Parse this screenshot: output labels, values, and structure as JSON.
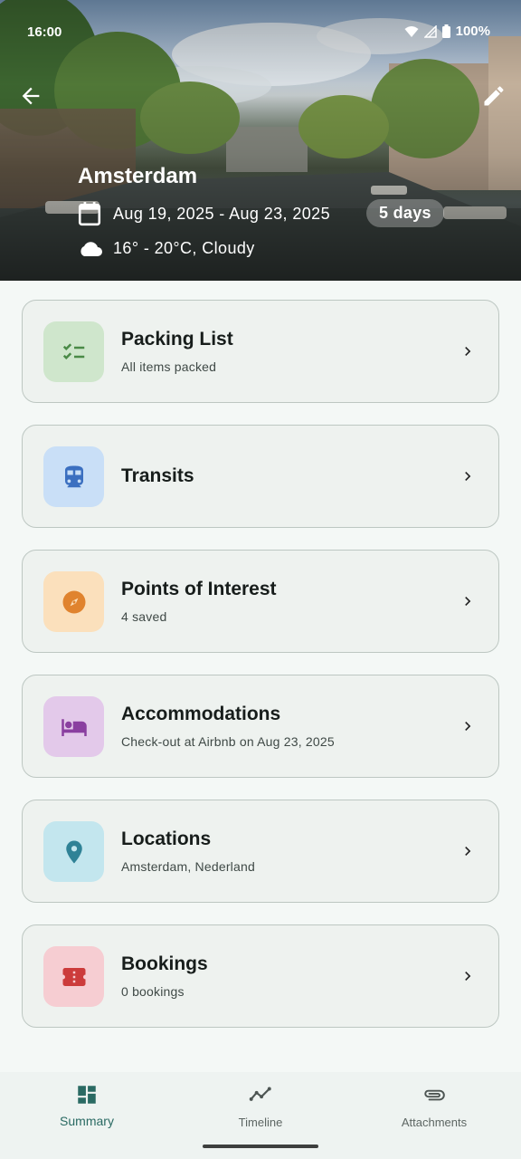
{
  "status_bar": {
    "time": "16:00",
    "battery": "100%"
  },
  "header": {
    "title": "Amsterdam",
    "date_range": "Aug 19, 2025 - Aug 23, 2025",
    "duration": "5 days",
    "weather": "16° - 20°C, Cloudy",
    "icons": {
      "back": "arrow-back-icon",
      "edit": "pencil-icon",
      "calendar": "calendar-icon",
      "weather": "cloud-icon"
    }
  },
  "cards": [
    {
      "title": "Packing List",
      "subtitle": "All items packed",
      "icon": "checklist-icon",
      "tile_color": "#cfe6cc",
      "icon_color": "#4a8a47"
    },
    {
      "title": "Transits",
      "subtitle": "",
      "icon": "train-icon",
      "tile_color": "#c9dff7",
      "icon_color": "#3b6fc0"
    },
    {
      "title": "Points of Interest",
      "subtitle": "4 saved",
      "icon": "compass-icon",
      "tile_color": "#fbe0bc",
      "icon_color": "#e0832e"
    },
    {
      "title": "Accommodations",
      "subtitle": "Check-out at Airbnb on Aug 23, 2025",
      "icon": "bed-icon",
      "tile_color": "#e3c9ea",
      "icon_color": "#8a3fa0"
    },
    {
      "title": "Locations",
      "subtitle": "Amsterdam, Nederland",
      "icon": "location-pin-icon",
      "tile_color": "#c3e6ee",
      "icon_color": "#2f8296"
    },
    {
      "title": "Bookings",
      "subtitle": "0 bookings",
      "icon": "ticket-icon",
      "tile_color": "#f6cdd2",
      "icon_color": "#cc3b3b"
    }
  ],
  "bottom_nav": {
    "items": [
      {
        "label": "Summary",
        "icon": "dashboard-icon",
        "active": true
      },
      {
        "label": "Timeline",
        "icon": "timeline-icon",
        "active": false
      },
      {
        "label": "Attachments",
        "icon": "paperclip-icon",
        "active": false
      }
    ],
    "accent_color": "#2a6a63"
  }
}
